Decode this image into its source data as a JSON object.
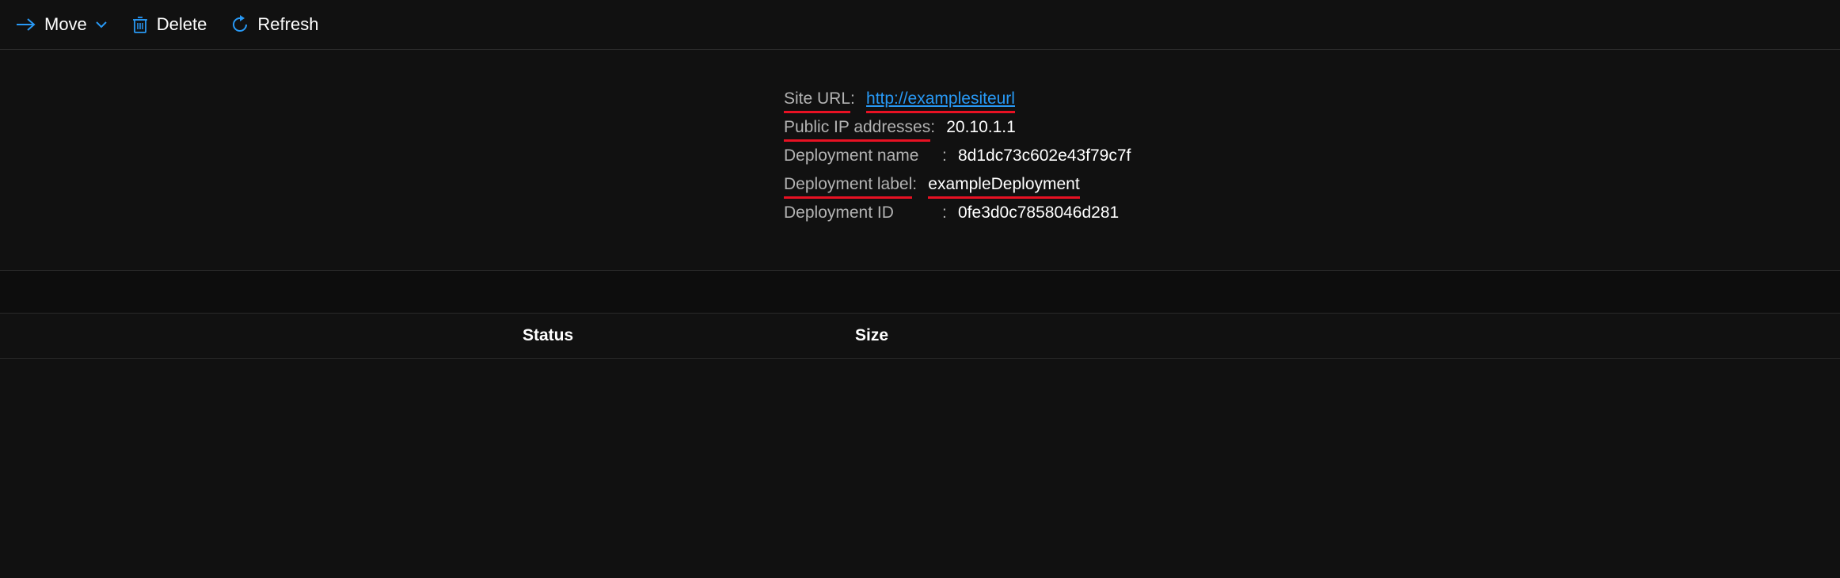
{
  "toolbar": {
    "move_label": "Move",
    "delete_label": "Delete",
    "refresh_label": "Refresh"
  },
  "properties": {
    "site_url": {
      "label": "Site URL",
      "value": "http://examplesiteurl"
    },
    "public_ip": {
      "label": "Public IP addresses",
      "value": "20.10.1.1"
    },
    "deployment_name": {
      "label": "Deployment name",
      "value": "8d1dc73c602e43f79c7f"
    },
    "deployment_label": {
      "label": "Deployment label",
      "value": "exampleDeployment"
    },
    "deployment_id": {
      "label": "Deployment ID",
      "value": "0fe3d0c7858046d281"
    }
  },
  "table": {
    "columns": {
      "status": "Status",
      "size": "Size"
    }
  }
}
